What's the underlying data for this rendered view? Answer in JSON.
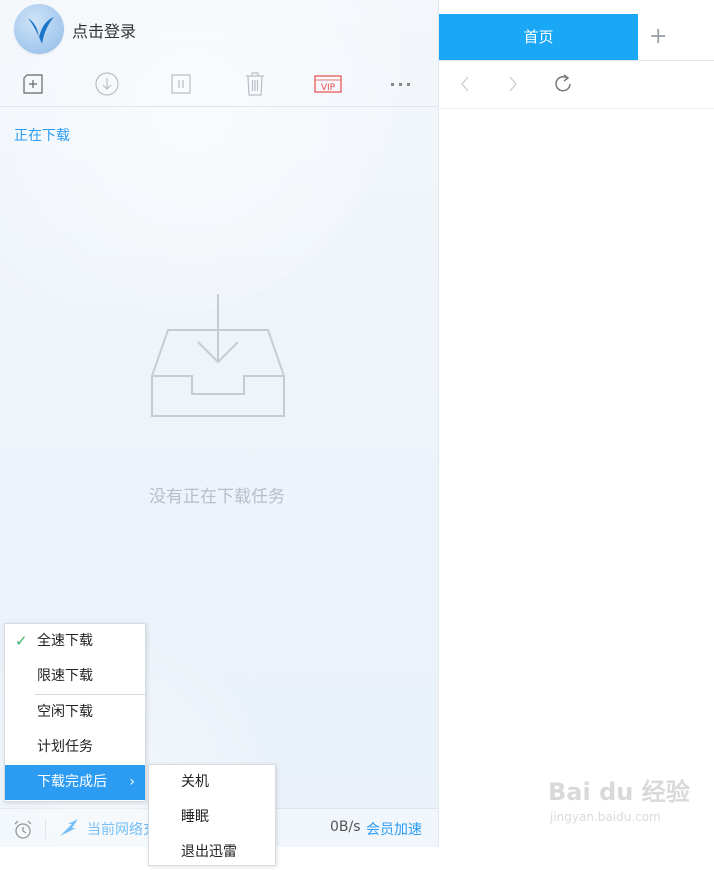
{
  "account": {
    "login_label": "点击登录"
  },
  "toolbar": {
    "new_icon": "plus-box-icon",
    "start_icon": "download-circle-icon",
    "pause_icon": "pause-icon",
    "delete_icon": "trash-icon",
    "vip_label": "VIP",
    "more_icon": "more-dots-icon",
    "vip_color": "#e84b4b"
  },
  "downloads": {
    "tab_label": "正在下载",
    "empty_message": "没有正在下载任务"
  },
  "speed_menu": {
    "items": [
      {
        "label": "全速下载",
        "checked": true
      },
      {
        "label": "限速下载"
      },
      {
        "label": "空闲下载"
      },
      {
        "label": "计划任务"
      },
      {
        "label": "下载完成后",
        "has_submenu": true
      }
    ]
  },
  "after_download_menu": {
    "items": [
      {
        "label": "关机"
      },
      {
        "label": "睡眠"
      },
      {
        "label": "退出迅雷"
      }
    ]
  },
  "statusbar": {
    "network_text": "当前网络充",
    "speed": "0B/s",
    "vip_accel": "会员加速"
  },
  "browser": {
    "home_tab": "首页",
    "add_tab": "+",
    "accent": "#1aa8f6"
  },
  "watermark": {
    "main": "Bai du 经验",
    "sub": "jingyan.baidu.com"
  },
  "colors": {
    "link": "#2b9cf2",
    "check": "#3bb36b"
  }
}
